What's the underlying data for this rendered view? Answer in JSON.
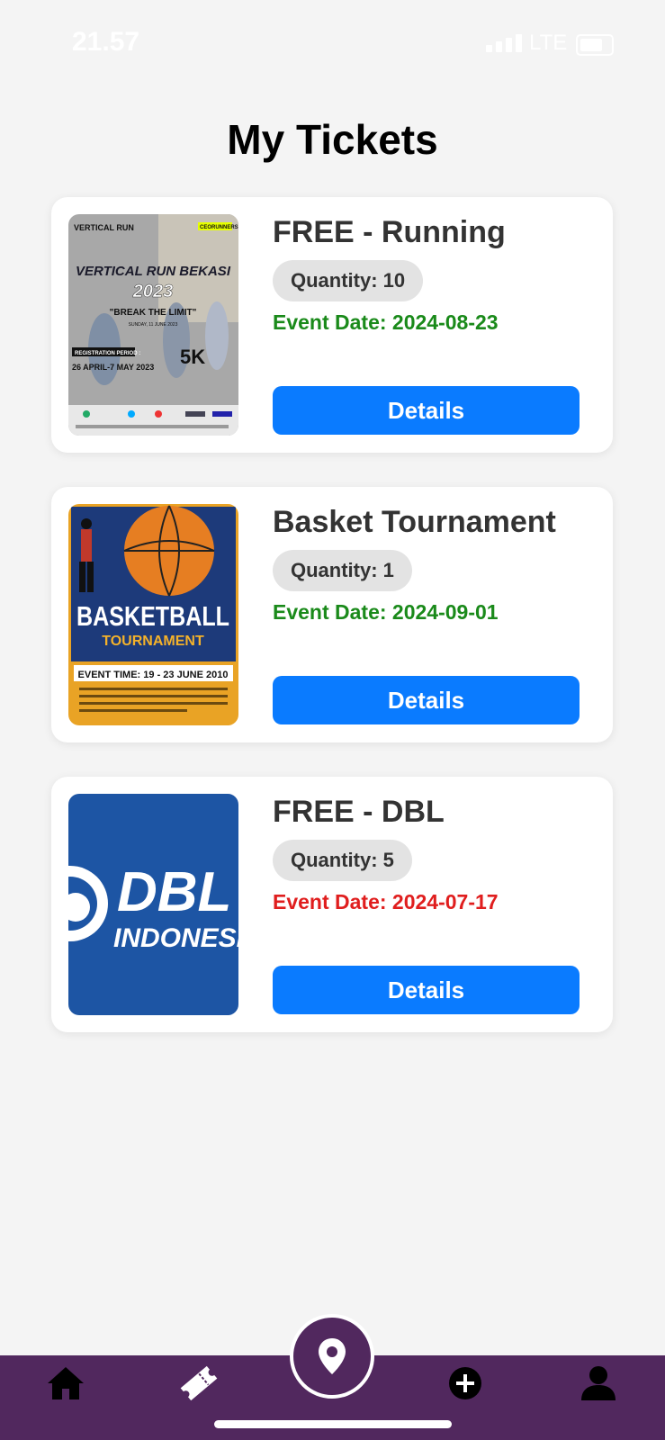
{
  "status": {
    "time": "21.57",
    "network": "LTE"
  },
  "page_title": "My Tickets",
  "tickets": [
    {
      "title": "FREE - Running",
      "quantity": "Quantity: 10",
      "event_date": "Event Date: 2024-08-23",
      "date_color": "#1a8a1a",
      "details_label": "Details",
      "image": {
        "brand": "VERTICAL RUN",
        "headline": "VERTICAL RUN BEKASI",
        "year": "2023",
        "tagline": "\"BREAK THE LIMIT\"",
        "date_line": "SUNDAY, 11 JUNE 2023",
        "period_label": "REGISTRATION PERIOD :",
        "period": "26 APRIL-7 MAY 2023",
        "distance": "5K",
        "sponsor": "CEORUNNERS"
      }
    },
    {
      "title": "Basket Tournament",
      "quantity": "Quantity: 1",
      "event_date": "Event Date: 2024-09-01",
      "date_color": "#1a8a1a",
      "details_label": "Details",
      "image": {
        "headline": "BASKETBALL",
        "subheadline": "TOURNAMENT",
        "event_time": "EVENT TIME:  19 - 23 JUNE 2010"
      }
    },
    {
      "title": "FREE - DBL",
      "quantity": "Quantity: 5",
      "event_date": "Event Date: 2024-07-17",
      "date_color": "#e01e1e",
      "details_label": "Details",
      "image": {
        "logo_line1": "DBL",
        "logo_line2": "INDONESIA"
      }
    }
  ],
  "nav": {
    "items": [
      "home-icon",
      "ticket-icon",
      "location-icon",
      "add-circle-icon",
      "profile-icon"
    ],
    "active_bg": "#51285e"
  }
}
